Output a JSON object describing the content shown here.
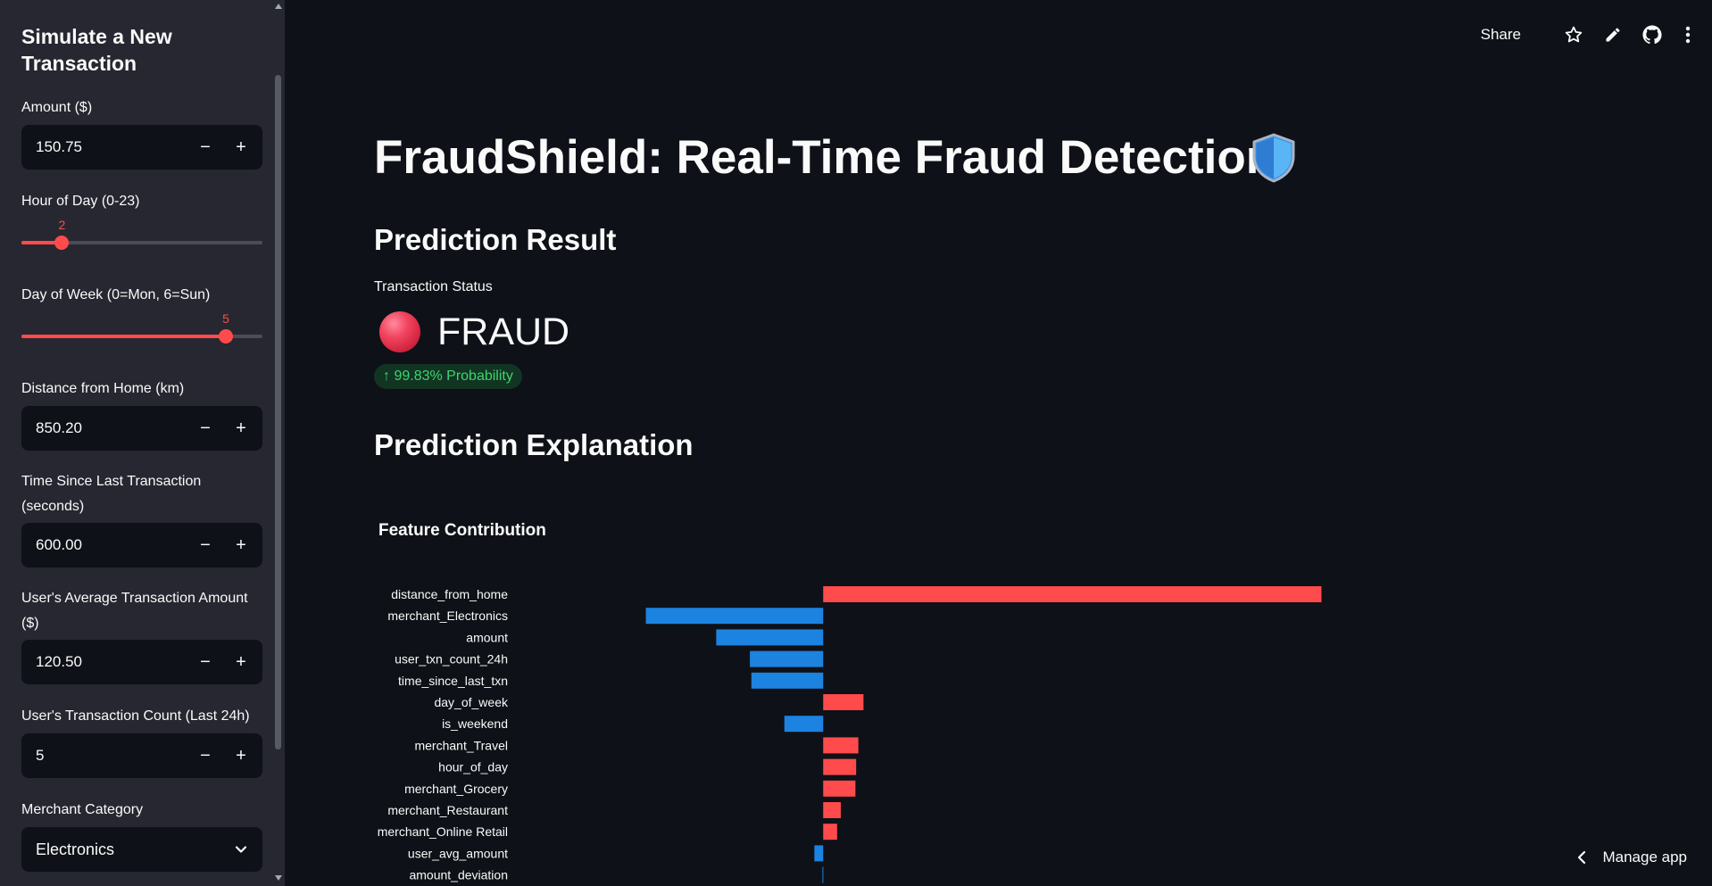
{
  "sidebar": {
    "title": "Simulate a New Transaction",
    "amount": {
      "label": "Amount ($)",
      "value": "150.75"
    },
    "hour": {
      "label": "Hour of Day (0-23)",
      "value": "2",
      "min": 0,
      "max": 23,
      "current": 2
    },
    "dow": {
      "label": "Day of Week (0=Mon, 6=Sun)",
      "value": "5",
      "min": 0,
      "max": 6,
      "current": 5
    },
    "distance": {
      "label": "Distance from Home (km)",
      "value": "850.20"
    },
    "time_since": {
      "label": "Time Since Last Transaction (seconds)",
      "value": "600.00"
    },
    "avg_amount": {
      "label": "User's Average Transaction Amount ($)",
      "value": "120.50"
    },
    "txn_count": {
      "label": "User's Transaction Count (Last 24h)",
      "value": "5"
    },
    "merchant": {
      "label": "Merchant Category",
      "value": "Electronics"
    },
    "minus": "−",
    "plus": "+"
  },
  "toolbar": {
    "share_label": "Share"
  },
  "main": {
    "title": "FraudShield: Real-Time Fraud Detection",
    "prediction_heading": "Prediction Result",
    "metric_label": "Transaction Status",
    "metric_value": "FRAUD",
    "delta": "↑ 99.83% Probability",
    "explanation_heading": "Prediction Explanation"
  },
  "manage_app": "Manage app",
  "colors": {
    "positive": "#ff4b4b",
    "negative": "#1c83e1",
    "accent": "#ff4b4b",
    "delta_green": "#3dd56d"
  },
  "chart_data": {
    "type": "bar",
    "orientation": "horizontal",
    "title": "Feature Contribution",
    "categories": [
      "distance_from_home",
      "merchant_Electronics",
      "amount",
      "user_txn_count_24h",
      "time_since_last_txn",
      "day_of_week",
      "is_weekend",
      "merchant_Travel",
      "hour_of_day",
      "merchant_Grocery",
      "merchant_Restaurant",
      "merchant_Online Retail",
      "user_avg_amount",
      "amount_deviation"
    ],
    "values": [
      6.8,
      -2.42,
      -1.46,
      -1.0,
      -0.98,
      0.55,
      -0.53,
      0.48,
      0.45,
      0.44,
      0.24,
      0.19,
      -0.12,
      -0.01
    ],
    "xlim": [
      -3.45,
      8.0
    ]
  }
}
